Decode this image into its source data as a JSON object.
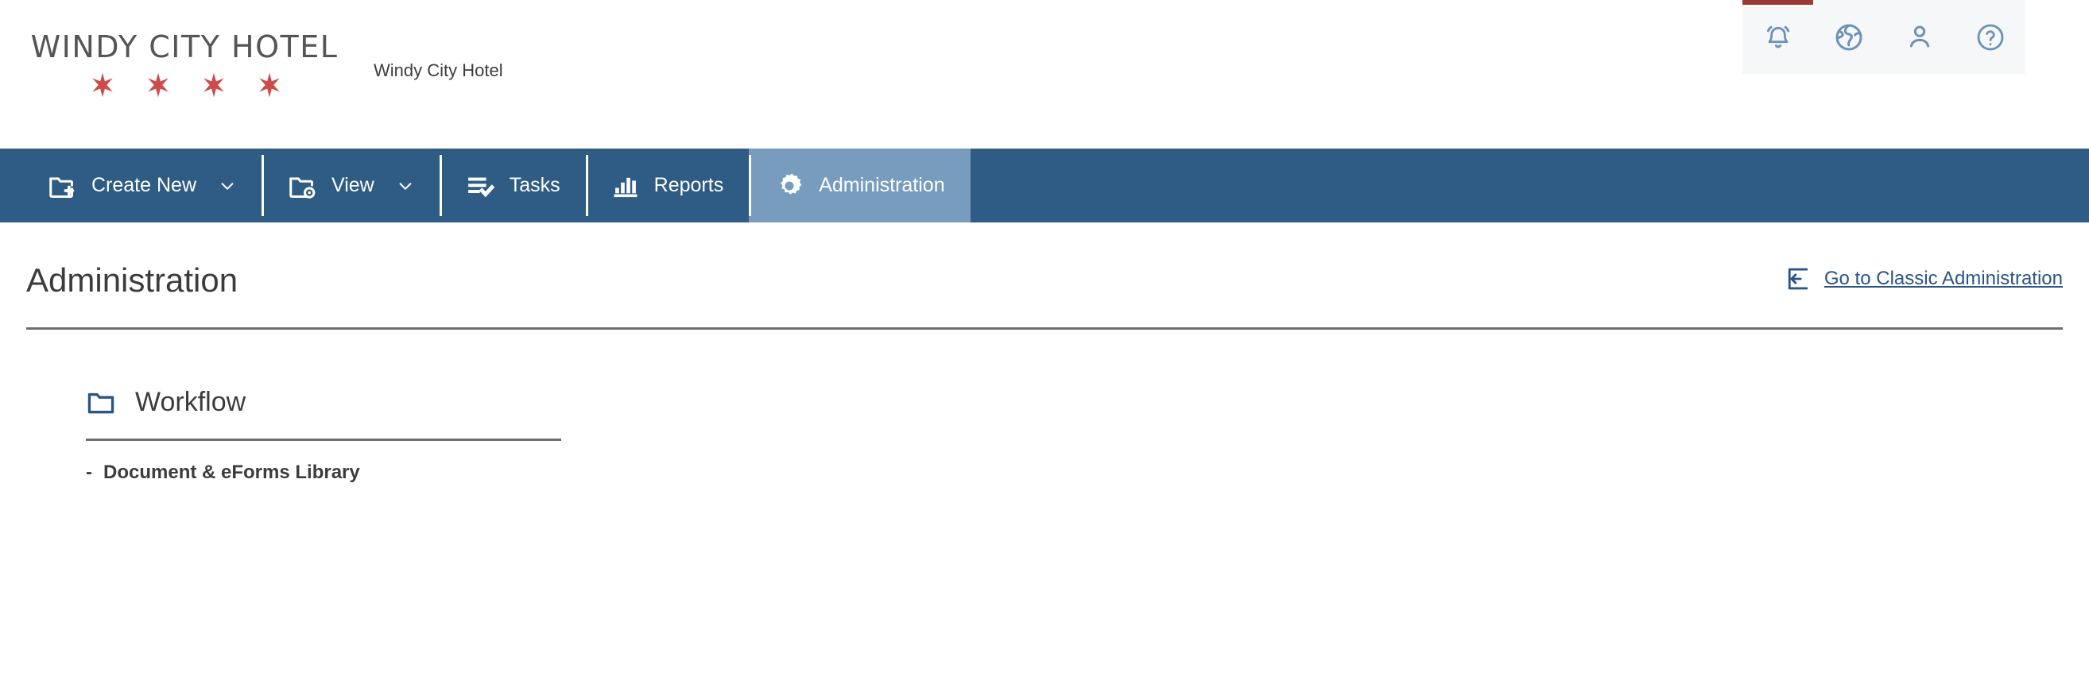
{
  "header": {
    "logo": {
      "wordmark": "WINDY CITY HOTEL",
      "star_count": 4,
      "star_color": "#cc4game",
      "star_color_hex": "#cc4b4b"
    },
    "brand_name": "Windy City Hotel",
    "utility_icons": [
      {
        "name": "notifications-icon",
        "glyph": "bell",
        "has_accent_bar": true,
        "accent_color": "#9b3b35"
      },
      {
        "name": "globe-icon",
        "glyph": "globe",
        "has_accent_bar": false
      },
      {
        "name": "user-profile-icon",
        "glyph": "person",
        "has_accent_bar": false
      },
      {
        "name": "help-icon",
        "glyph": "question-circle",
        "has_accent_bar": false
      }
    ]
  },
  "nav": {
    "background_color": "#2e5c85",
    "active_color": "#789cbe",
    "items": [
      {
        "label": "Create New",
        "icon": "folder-plus-icon",
        "has_caret": true,
        "active": false
      },
      {
        "label": "View",
        "icon": "folder-eye-icon",
        "has_caret": true,
        "active": false
      },
      {
        "label": "Tasks",
        "icon": "task-list-icon",
        "has_caret": false,
        "active": false
      },
      {
        "label": "Reports",
        "icon": "bar-chart-icon",
        "has_caret": false,
        "active": false
      },
      {
        "label": "Administration",
        "icon": "gear-icon",
        "has_caret": false,
        "active": true
      }
    ]
  },
  "main": {
    "page_title": "Administration",
    "classic_link": {
      "label": "Go to Classic Administration",
      "icon": "exit-left-arrow-icon",
      "color": "#2b5584"
    },
    "sections": [
      {
        "title": "Workflow",
        "icon": "folder-icon",
        "icon_color": "#2b5584",
        "items": [
          {
            "bullet": "-",
            "label": "Document & eForms Library"
          }
        ]
      }
    ]
  }
}
